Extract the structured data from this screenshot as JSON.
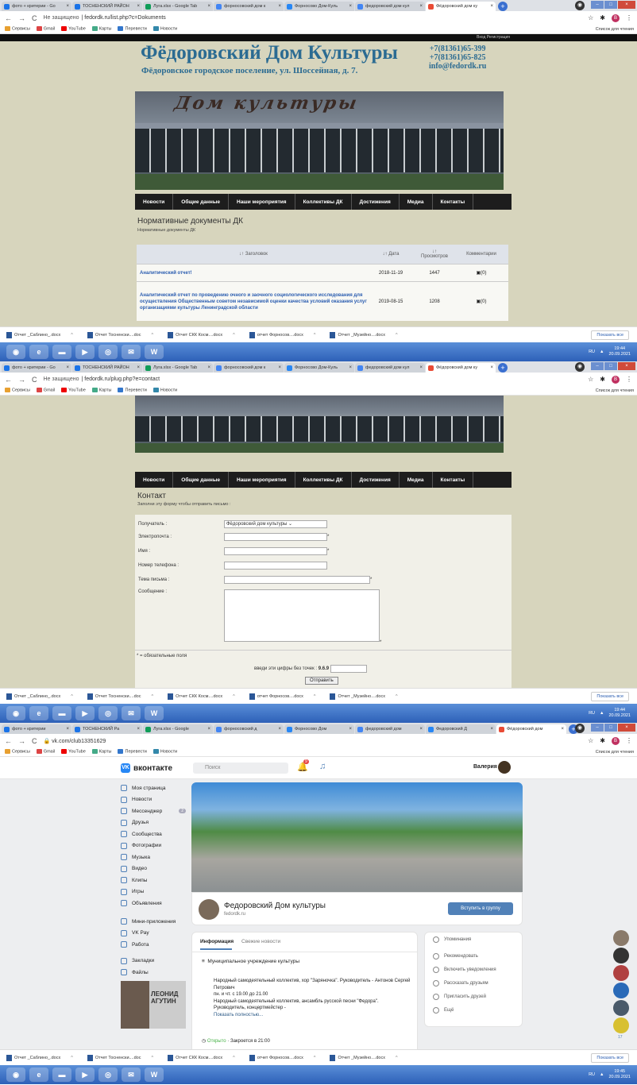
{
  "tabs": [
    {
      "label": "фото + критерии - Go",
      "color": "#1a73e8"
    },
    {
      "label": "ТОСНЕНСКИЙ РАЙОН",
      "color": "#1a73e8"
    },
    {
      "label": "Лyra.xlsx - Google Tab",
      "color": "#0f9d58"
    },
    {
      "label": "форносовский дом к",
      "color": "#4285f4"
    },
    {
      "label": "Форносово Дом-Куль",
      "color": "#2787f5"
    },
    {
      "label": "федоровский дом кул",
      "color": "#4285f4"
    },
    {
      "label": "Фёдоровский дом ку",
      "color": "#e94b35"
    }
  ],
  "tabs3": [
    {
      "label": "фото + критерии",
      "color": "#1a73e8"
    },
    {
      "label": "ТОСНЕНСКИЙ Ра",
      "color": "#1a73e8"
    },
    {
      "label": "Лyra.xlsx - Google",
      "color": "#0f9d58"
    },
    {
      "label": "форносовский д",
      "color": "#4285f4"
    },
    {
      "label": "Форносово Дом",
      "color": "#2787f5"
    },
    {
      "label": "федоровский дом",
      "color": "#4285f4"
    },
    {
      "label": "Федоровский Д",
      "color": "#2787f5"
    },
    {
      "label": "Фёдоровский дом",
      "color": "#e94b35"
    }
  ],
  "addr": {
    "insecure": "Не защищено",
    "url1": "fedordk.ru/list.php?c=Dokuments",
    "url2": "fedordk.ru/plug.php?e=contact",
    "url3": "vk.com/club13351629"
  },
  "bookmarks": [
    "Сервисы",
    "Gmail",
    "YouTube",
    "Карты",
    "Перевести",
    "Новости"
  ],
  "reading_list": "Список для чтения",
  "downloads": [
    "Отчет _Саблино_.docx",
    "Отчет Тосненски....doc",
    "Отчет СКК Косм....docx",
    "отчет Форносов....docx",
    "Отчет _Музейно....docx"
  ],
  "downloads_show_all": "Показать все",
  "taskbar": {
    "lang": "RU",
    "time1": "19:44",
    "date1": "20.09.2021",
    "time3": "19:45"
  },
  "site": {
    "login": "Вход  Регистрация",
    "title": "Фёдоровский Дом Культуры",
    "subtitle": "Фёдоровское городское поселение, ул. Шоссейная, д. 7.",
    "phone1": "+7(81361)65-399",
    "phone2": "+7(81361)65-825",
    "email": "info@fedordk.ru",
    "banner_text": "Дом культуры",
    "menu": [
      "Новости",
      "Общие данные",
      "Наши мероприятия",
      "Коллективы ДК",
      "Достижения",
      "Медиа",
      "Контакты"
    ]
  },
  "docs": {
    "title": "Нормативные документы ДК",
    "crumb": "Нормативные документы ДК",
    "headers": [
      "Заголовок",
      "Дата",
      "Просмотров",
      "Комментарии"
    ],
    "rows": [
      {
        "title": "Аналитический отчет!",
        "date": "2018-11-19",
        "views": "1447",
        "comments": "(0)"
      },
      {
        "title": "Аналитический отчет по проведению очного и заочного социологического исследования для осуществления Общественным советом независимой оценки качества условий оказания услуг организациями культуры Ленинградской области",
        "date": "2019-08-15",
        "views": "1208",
        "comments": "(0)"
      }
    ]
  },
  "contact": {
    "title": "Контакт",
    "sub": "Заполни эту форму чтобы отправить письмо :",
    "recipient_label": "Получатель :",
    "recipient_value": "Фёдоровский дом культуры",
    "email_label": "Электропочта :",
    "name_label": "Имя :",
    "phone_label": "Номер телефона :",
    "subject_label": "Тема письма :",
    "message_label": "Сообщение :",
    "required_note": "* = обязательные поля",
    "captcha_label": "введи эти цифры без точек :",
    "captcha_value": "9.6.9",
    "submit": "Отправить",
    "star": "*"
  },
  "vk": {
    "logo": "вконтакте",
    "search": "Поиск",
    "user": "Валерия",
    "notif_count": "9",
    "left": [
      "Моя страница",
      "Новости",
      "Мессенджер",
      "Друзья",
      "Сообщества",
      "Фотографии",
      "Музыка",
      "Видео",
      "Клипы",
      "Игры",
      "Объявления"
    ],
    "left2": [
      "Мини-приложения",
      "VK Pay",
      "Работа"
    ],
    "left3": [
      "Закладки",
      "Файлы"
    ],
    "msg_count": "2",
    "ad_name": "ЛЕОНИД АГУТИН",
    "group_name": "Федоровский Дом культуры",
    "group_site": "fedordk.ru",
    "join": "Вступить в группу",
    "info_tab": "Информация",
    "news_tab": "Свежие новости",
    "org_type": "Муниципальное учреждение культуры",
    "desc1": "Народный самодеятельный коллектив, хор \"Заряночка\". Руководитель - Антонов Сергей Петрович",
    "desc2": "пн. и чт. с 19.00 до 21.00",
    "desc3": "Народный самодеятельный коллектив, ансамбль русской песни \"Федора\". Руководитель, концертмейстер -",
    "show_more": "Показать полностью...",
    "open": "Открыто",
    "closes": " · Закроется в 21:00",
    "right": [
      "Упоминания",
      "Рекомендовать",
      "Включить уведомления",
      "Рассказать друзьям",
      "Пригласить друзей",
      "Ещё"
    ],
    "side_count": "17"
  }
}
